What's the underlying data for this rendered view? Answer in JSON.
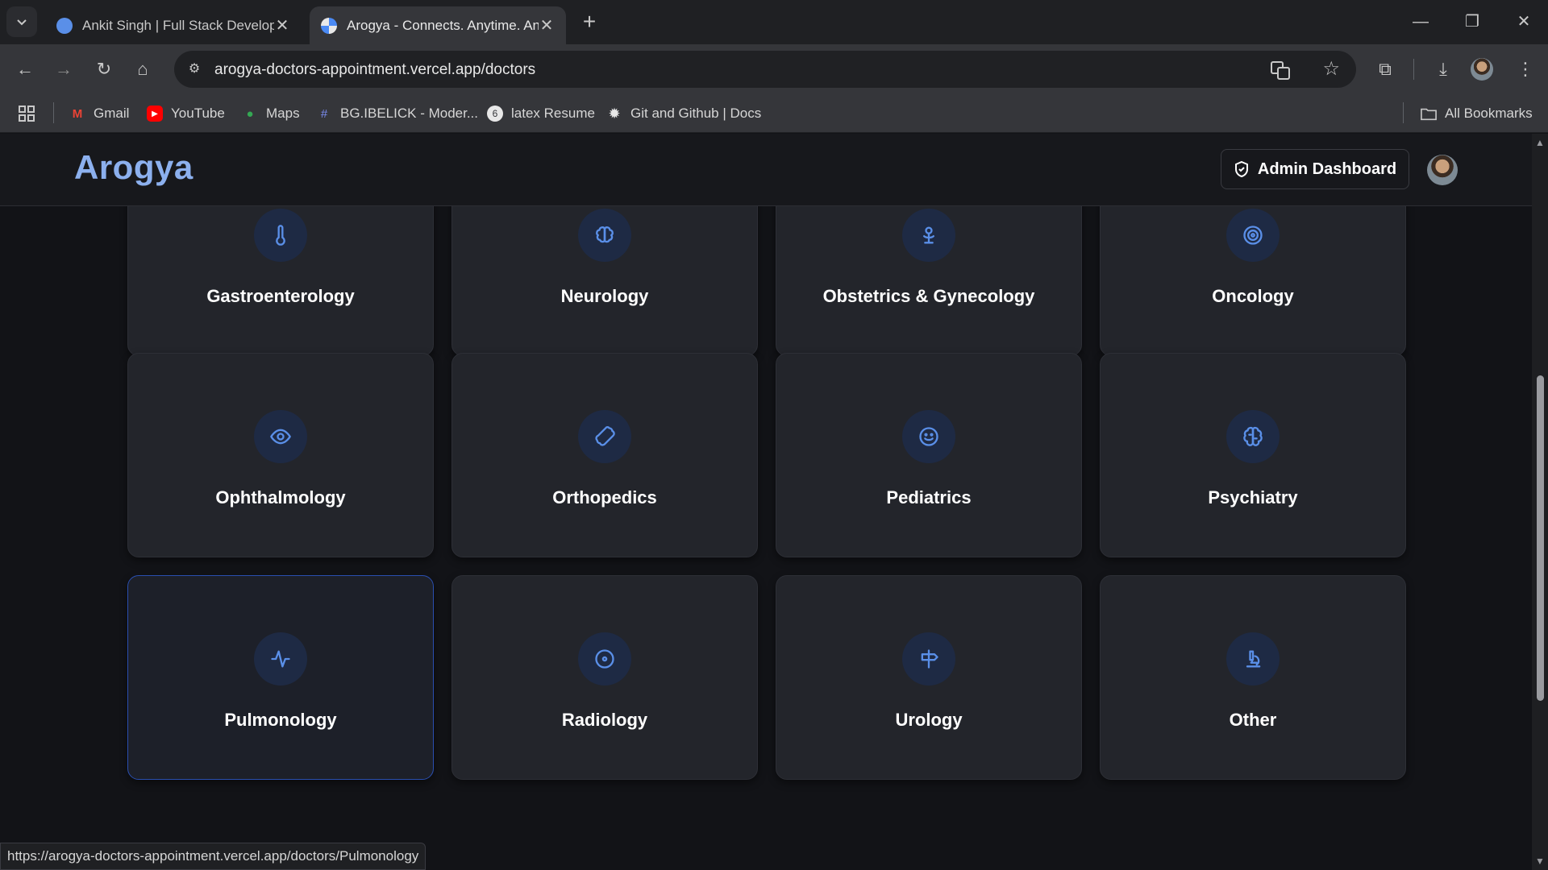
{
  "browser": {
    "tabs": [
      {
        "title": "Ankit Singh | Full Stack Develop",
        "active": false
      },
      {
        "title": "Arogya - Connects. Anytime. An",
        "active": true
      }
    ],
    "url": "arogya-doctors-appointment.vercel.app/doctors",
    "bookmarks": [
      {
        "label": "Gmail",
        "icon": "gmail-icon"
      },
      {
        "label": "YouTube",
        "icon": "youtube-icon"
      },
      {
        "label": "Maps",
        "icon": "maps-icon"
      },
      {
        "label": "BG.IBELICK - Moder...",
        "icon": "hash-icon"
      },
      {
        "label": "latex Resume",
        "icon": "overleaf-icon"
      },
      {
        "label": "Git and Github | Docs",
        "icon": "gear-icon"
      }
    ],
    "all_bookmarks": "All Bookmarks",
    "status_url": "https://arogya-doctors-appointment.vercel.app/doctors/Pulmonology"
  },
  "app": {
    "logo": "Arogya",
    "admin_button": "Admin Dashboard"
  },
  "specialties": [
    {
      "name": "Gastroenterology",
      "icon": "thermometer-icon"
    },
    {
      "name": "Neurology",
      "icon": "brain-icon"
    },
    {
      "name": "Obstetrics & Gynecology",
      "icon": "baby-icon"
    },
    {
      "name": "Oncology",
      "icon": "target-icon"
    },
    {
      "name": "Ophthalmology",
      "icon": "eye-icon"
    },
    {
      "name": "Orthopedics",
      "icon": "bone-icon"
    },
    {
      "name": "Pediatrics",
      "icon": "smile-icon"
    },
    {
      "name": "Psychiatry",
      "icon": "brain-icon"
    },
    {
      "name": "Pulmonology",
      "icon": "activity-icon"
    },
    {
      "name": "Radiology",
      "icon": "radio-icon"
    },
    {
      "name": "Urology",
      "icon": "signpost-icon"
    },
    {
      "name": "Other",
      "icon": "microscope-icon"
    }
  ],
  "colors": {
    "accent": "#5a8fe8",
    "logo": "#8cb0ee",
    "card_bg": "#23252b",
    "page_bg": "#121317"
  }
}
